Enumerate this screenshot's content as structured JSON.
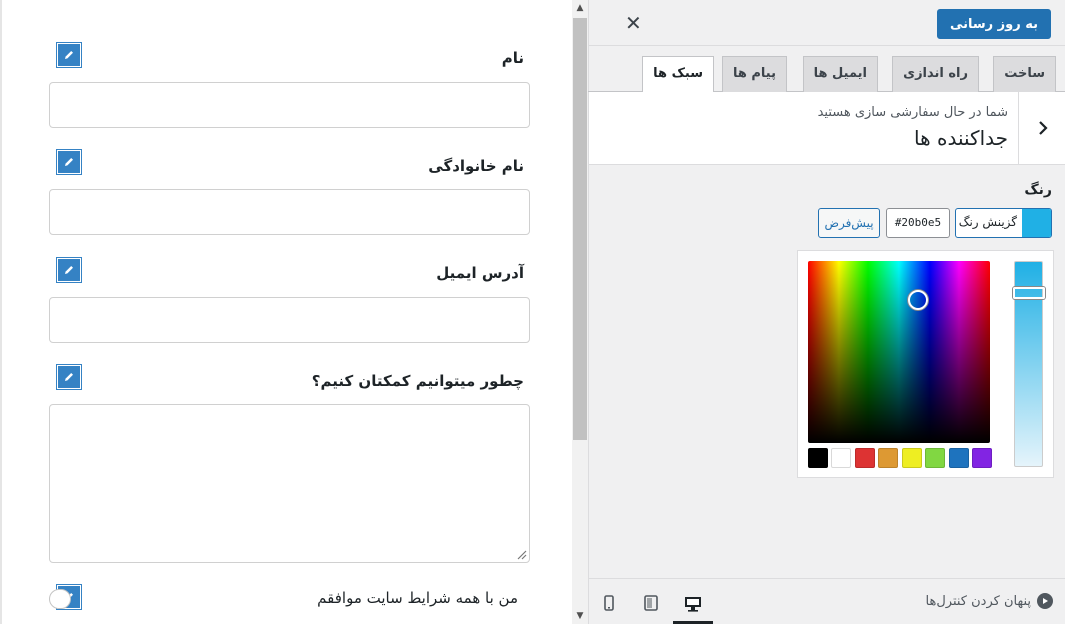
{
  "preview": {
    "fields": [
      {
        "label": "نام"
      },
      {
        "label": "نام خانوادگی"
      },
      {
        "label": "آدرس ایمیل"
      },
      {
        "label": "چطور میتوانیم کمکتان کنیم؟"
      }
    ],
    "agree_label": "من با همه شرایط سایت موافقم"
  },
  "panel": {
    "update_button": "به روز رسانی",
    "close_icon": "close-icon",
    "tabs": [
      {
        "label": "ساخت"
      },
      {
        "label": "راه اندازی"
      },
      {
        "label": "ایمیل ها"
      },
      {
        "label": "پیام ها"
      },
      {
        "label": "سبک ها"
      }
    ],
    "active_tab": "سبک ها",
    "section": {
      "subtitle": "شما در حال سفارشی سازی هستید",
      "title": "جداکننده ها"
    },
    "color": {
      "label": "رنگ",
      "select_button": "گزینش رنگ",
      "value": "#20b0e5",
      "default_button": "پیش‌فرض",
      "swatch_color": "#20b0e5",
      "palette": [
        "#000000",
        "#ffffff",
        "#dd3333",
        "#dd9933",
        "#eeee22",
        "#81d742",
        "#1e73be",
        "#8224e3"
      ]
    },
    "footer": {
      "hide_controls": "پنهان کردن کنترل‌ها",
      "devices": [
        "mobile-icon",
        "tablet-icon",
        "desktop-icon"
      ],
      "active_device": "desktop-icon"
    }
  }
}
